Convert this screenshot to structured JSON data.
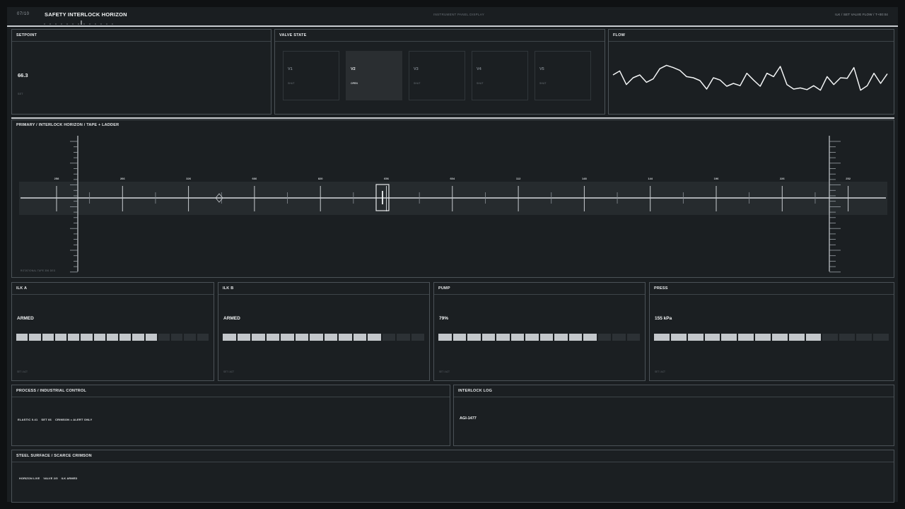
{
  "header": {
    "page_counter": "07/10",
    "title": "SAFETY INTERLOCK HORIZON",
    "mode": "INSTRUMENT PANEL DISPLAY",
    "status": "ILK / SET VALVE FLOW / T+00:04"
  },
  "setpoint": {
    "title": "SETPOINT",
    "value": "66.3",
    "sub": "SET"
  },
  "valve_state": {
    "title": "VALVE STATE",
    "valves": [
      {
        "name": "V1",
        "state": "SHUT",
        "active": false
      },
      {
        "name": "V2",
        "state": "OPEN",
        "active": true
      },
      {
        "name": "V3",
        "state": "SHUT",
        "active": false
      },
      {
        "name": "V4",
        "state": "SHUT",
        "active": false
      },
      {
        "name": "V5",
        "state": "SHUT",
        "active": false
      }
    ]
  },
  "flow": {
    "title": "FLOW",
    "values": [
      55,
      62,
      38,
      50,
      55,
      42,
      48,
      66,
      72,
      68,
      63,
      52,
      50,
      45,
      30,
      50,
      46,
      35,
      40,
      36,
      58,
      46,
      35,
      58,
      52,
      70,
      38,
      30,
      32,
      29,
      36,
      28,
      52,
      38,
      50,
      49,
      68,
      28,
      36,
      58,
      40,
      57
    ]
  },
  "tape": {
    "title": "PRIMARY / INTERLOCK HORIZON / TAPE + LADDER",
    "tick_labels": [
      "258",
      "266",
      "326",
      "666",
      "820",
      "656",
      "604",
      "112",
      "148",
      "144",
      "196",
      "226",
      "252"
    ],
    "foot": "ROTATIONAL TAPE 356 DEG"
  },
  "gauges": [
    {
      "title": "ILK A",
      "value": "ARMED",
      "level": 0.73,
      "segments": 15,
      "foot": "SET / ACT"
    },
    {
      "title": "ILK B",
      "value": "ARMED",
      "level": 0.79,
      "segments": 14,
      "foot": "SET / ACT"
    },
    {
      "title": "PUMP",
      "value": "79%",
      "level": 0.79,
      "segments": 14,
      "foot": "SET / ACT"
    },
    {
      "title": "PRESS",
      "value": "155 kPa",
      "level": 0.7,
      "segments": 14,
      "foot": "SET / ACT"
    }
  ],
  "process": {
    "title": "PROCESS / INDUSTRIAL CONTROL",
    "tags": [
      "ELASTIC 0.41",
      "SET 66",
      "CRIMSON = ALERT ONLY"
    ]
  },
  "interlock_log": {
    "title": "INTERLOCK LOG",
    "entry": "AGI-1477"
  },
  "surface": {
    "title": "STEEL SURFACE / SCARCE CRIMSON",
    "tags": [
      "HORIZON LIVE",
      "VALVE 2/5",
      "ILK ARMED"
    ]
  },
  "colors": {
    "background": "#1a1e21",
    "border": "#4b5257",
    "accent": "#c3c7cb",
    "text": "#e6e8ea"
  }
}
